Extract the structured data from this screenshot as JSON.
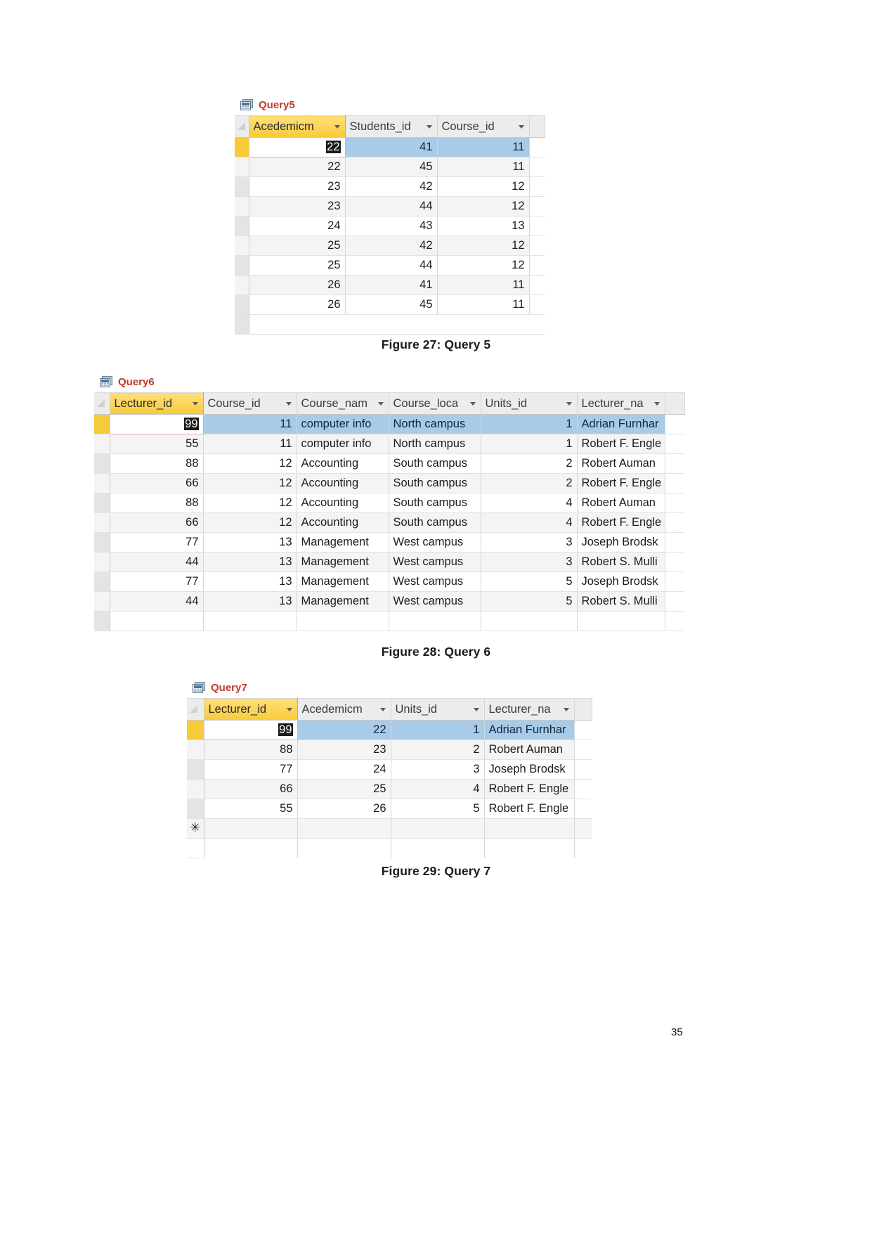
{
  "page": {
    "number": "35"
  },
  "figures": [
    {
      "caption": "Figure 27: Query 5"
    },
    {
      "caption": "Figure 28: Query 6"
    },
    {
      "caption": "Figure 29: Query 7"
    }
  ],
  "query5": {
    "tab_label": "Query5",
    "tab_icon": "query-datasheet-icon",
    "columns": [
      {
        "label": "Acedemicm",
        "selected": true
      },
      {
        "label": "Students_id",
        "selected": false
      },
      {
        "label": "Course_id",
        "selected": false
      }
    ],
    "rows": [
      {
        "acedemicm": "22",
        "students_id": "41",
        "course_id": "11"
      },
      {
        "acedemicm": "22",
        "students_id": "45",
        "course_id": "11"
      },
      {
        "acedemicm": "23",
        "students_id": "42",
        "course_id": "12"
      },
      {
        "acedemicm": "23",
        "students_id": "44",
        "course_id": "12"
      },
      {
        "acedemicm": "24",
        "students_id": "43",
        "course_id": "13"
      },
      {
        "acedemicm": "25",
        "students_id": "42",
        "course_id": "12"
      },
      {
        "acedemicm": "25",
        "students_id": "44",
        "course_id": "12"
      },
      {
        "acedemicm": "26",
        "students_id": "41",
        "course_id": "11"
      },
      {
        "acedemicm": "26",
        "students_id": "45",
        "course_id": "11"
      }
    ],
    "active_cell_value": "22"
  },
  "query6": {
    "tab_label": "Query6",
    "tab_icon": "query-datasheet-icon",
    "columns": [
      {
        "label": "Lecturer_id",
        "selected": true
      },
      {
        "label": "Course_id",
        "selected": false
      },
      {
        "label": "Course_nam",
        "selected": false
      },
      {
        "label": "Course_loca",
        "selected": false
      },
      {
        "label": "Units_id",
        "selected": false
      },
      {
        "label": "Lecturer_na",
        "selected": false
      }
    ],
    "rows": [
      {
        "lecturer_id": "99",
        "course_id": "11",
        "course_name": "computer info",
        "course_location": "North campus",
        "units_id": "1",
        "lecturer_name": "Adrian Furnhar"
      },
      {
        "lecturer_id": "55",
        "course_id": "11",
        "course_name": "computer info",
        "course_location": "North campus",
        "units_id": "1",
        "lecturer_name": "Robert F. Engle"
      },
      {
        "lecturer_id": "88",
        "course_id": "12",
        "course_name": "Accounting",
        "course_location": "South campus",
        "units_id": "2",
        "lecturer_name": "Robert Auman"
      },
      {
        "lecturer_id": "66",
        "course_id": "12",
        "course_name": "Accounting",
        "course_location": "South campus",
        "units_id": "2",
        "lecturer_name": "Robert F. Engle"
      },
      {
        "lecturer_id": "88",
        "course_id": "12",
        "course_name": "Accounting",
        "course_location": "South campus",
        "units_id": "4",
        "lecturer_name": "Robert Auman"
      },
      {
        "lecturer_id": "66",
        "course_id": "12",
        "course_name": "Accounting",
        "course_location": "South campus",
        "units_id": "4",
        "lecturer_name": "Robert F. Engle"
      },
      {
        "lecturer_id": "77",
        "course_id": "13",
        "course_name": "Management",
        "course_location": "West campus",
        "units_id": "3",
        "lecturer_name": "Joseph Brodsk"
      },
      {
        "lecturer_id": "44",
        "course_id": "13",
        "course_name": "Management",
        "course_location": "West campus",
        "units_id": "3",
        "lecturer_name": "Robert S. Mulli"
      },
      {
        "lecturer_id": "77",
        "course_id": "13",
        "course_name": "Management",
        "course_location": "West campus",
        "units_id": "5",
        "lecturer_name": "Joseph Brodsk"
      },
      {
        "lecturer_id": "44",
        "course_id": "13",
        "course_name": "Management",
        "course_location": "West campus",
        "units_id": "5",
        "lecturer_name": "Robert S. Mulli"
      }
    ],
    "active_cell_value": "99"
  },
  "query7": {
    "tab_label": "Query7",
    "tab_icon": "query-datasheet-icon",
    "columns": [
      {
        "label": "Lecturer_id",
        "selected": true
      },
      {
        "label": "Acedemicm",
        "selected": false
      },
      {
        "label": "Units_id",
        "selected": false
      },
      {
        "label": "Lecturer_na",
        "selected": false
      }
    ],
    "rows": [
      {
        "lecturer_id": "99",
        "acedemicm": "22",
        "units_id": "1",
        "lecturer_name": "Adrian Furnhar"
      },
      {
        "lecturer_id": "88",
        "acedemicm": "23",
        "units_id": "2",
        "lecturer_name": "Robert Auman"
      },
      {
        "lecturer_id": "77",
        "acedemicm": "24",
        "units_id": "3",
        "lecturer_name": "Joseph Brodsk"
      },
      {
        "lecturer_id": "66",
        "acedemicm": "25",
        "units_id": "4",
        "lecturer_name": "Robert F. Engle"
      },
      {
        "lecturer_id": "55",
        "acedemicm": "26",
        "units_id": "5",
        "lecturer_name": "Robert F. Engle"
      }
    ],
    "active_cell_value": "99",
    "new_record_marker": "✳"
  },
  "colors": {
    "tab_title": "#c0392b",
    "selected_column_header": "#f7ca3a",
    "selected_row": "#a8cbe8",
    "alt_row": "#f4f4f4",
    "header": "#ececec"
  }
}
